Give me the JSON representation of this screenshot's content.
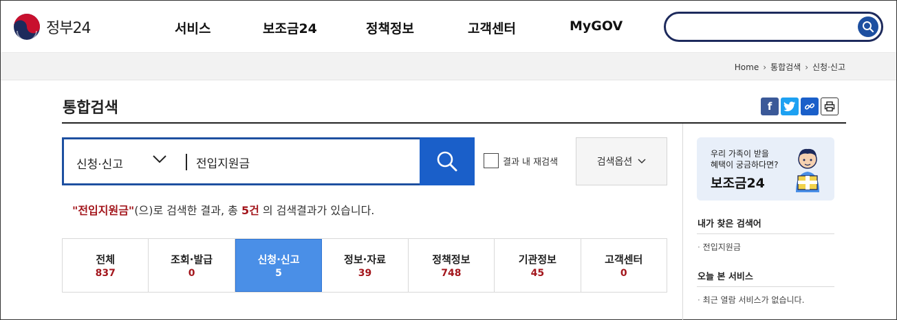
{
  "header": {
    "logo_text": "정부24",
    "nav": [
      "서비스",
      "보조금24",
      "정책정보",
      "고객센터",
      "MyGOV"
    ],
    "search": {
      "value": "",
      "placeholder": ""
    }
  },
  "breadcrumb": [
    "Home",
    "통합검색",
    "신청·신고"
  ],
  "page_title": "통합검색",
  "share_icons": [
    "facebook-icon",
    "twitter-icon",
    "link-icon",
    "print-icon"
  ],
  "search": {
    "category": "신청·신고",
    "query": "전입지원금",
    "re_search_label": "결과 내 재검색",
    "re_search_checked": false,
    "options_label": "검색옵션"
  },
  "result": {
    "query_quoted": "\"전입지원금\"",
    "text_mid": "(으)로 검색한 결과, 총 ",
    "count": "5건",
    "text_end": " 의 검색결과가 있습니다."
  },
  "tabs": [
    {
      "label": "전체",
      "count": "837",
      "active": false
    },
    {
      "label": "조회·발급",
      "count": "0",
      "active": false
    },
    {
      "label": "신청·신고",
      "count": "5",
      "active": true
    },
    {
      "label": "정보·자료",
      "count": "39",
      "active": false
    },
    {
      "label": "정책정보",
      "count": "748",
      "active": false
    },
    {
      "label": "기관정보",
      "count": "45",
      "active": false
    },
    {
      "label": "고객센터",
      "count": "0",
      "active": false
    }
  ],
  "sidebar": {
    "banner": {
      "line1": "우리 가족이 받을",
      "line2": "혜택이 궁금하다면?",
      "title": "보조금24"
    },
    "recent_searches_title": "내가 찾은 검색어",
    "recent_searches": [
      "전입지원금"
    ],
    "recent_services_title": "오늘 본 서비스",
    "recent_services_empty": "최근 열람 서비스가 없습니다."
  },
  "colors": {
    "primary": "#1a5fc9",
    "navy": "#1d2a5c",
    "active_tab": "#4a8fe7",
    "highlight_red": "#a3161c"
  }
}
